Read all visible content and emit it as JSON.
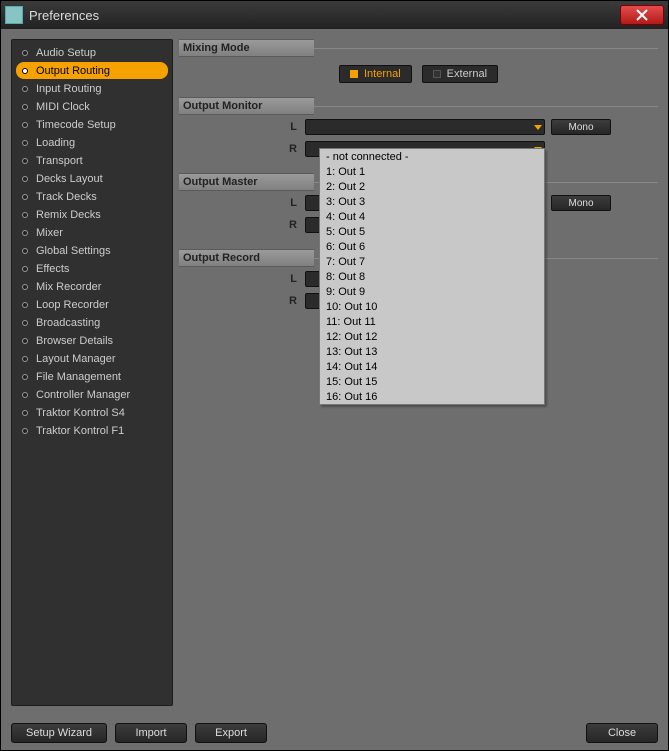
{
  "window": {
    "title": "Preferences"
  },
  "sidebar": {
    "items": [
      {
        "label": "Audio Setup"
      },
      {
        "label": "Output Routing",
        "selected": true
      },
      {
        "label": "Input Routing"
      },
      {
        "label": "MIDI Clock"
      },
      {
        "label": "Timecode Setup"
      },
      {
        "label": "Loading"
      },
      {
        "label": "Transport"
      },
      {
        "label": "Decks Layout"
      },
      {
        "label": "Track Decks"
      },
      {
        "label": "Remix Decks"
      },
      {
        "label": "Mixer"
      },
      {
        "label": "Global Settings"
      },
      {
        "label": "Effects"
      },
      {
        "label": "Mix Recorder"
      },
      {
        "label": "Loop Recorder"
      },
      {
        "label": "Broadcasting"
      },
      {
        "label": "Browser Details"
      },
      {
        "label": "Layout Manager"
      },
      {
        "label": "File Management"
      },
      {
        "label": "Controller Manager"
      },
      {
        "label": "Traktor Kontrol S4"
      },
      {
        "label": "Traktor Kontrol F1"
      }
    ]
  },
  "sections": {
    "mixing_mode": {
      "title": "Mixing Mode",
      "internal_label": "Internal",
      "external_label": "External",
      "active": "internal"
    },
    "output_monitor": {
      "title": "Output Monitor",
      "L_label": "L",
      "R_label": "R",
      "mono_label": "Mono"
    },
    "output_master": {
      "title": "Output Master",
      "L_label": "L",
      "R_label": "R",
      "mono_label": "Mono"
    },
    "output_record": {
      "title": "Output Record",
      "L_label": "L",
      "R_label": "R"
    }
  },
  "dropdown_options": [
    "- not connected -",
    "1: Out 1",
    "2: Out 2",
    "3: Out 3",
    "4: Out 4",
    "5: Out 5",
    "6: Out 6",
    "7: Out 7",
    "8: Out 8",
    "9: Out 9",
    "10: Out 10",
    "11: Out 11",
    "12: Out 12",
    "13: Out 13",
    "14: Out 14",
    "15: Out 15",
    "16: Out 16"
  ],
  "footer": {
    "setup_wizard": "Setup Wizard",
    "import": "Import",
    "export": "Export",
    "close": "Close"
  }
}
